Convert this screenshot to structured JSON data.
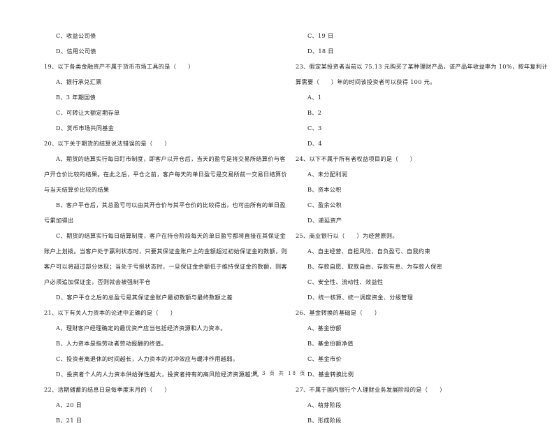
{
  "left_column": [
    {
      "type": "opt",
      "text": "C、收益公司债"
    },
    {
      "type": "opt",
      "text": "D、信用公司债"
    },
    {
      "type": "q",
      "text": "19、以下各类金融资产不属于货币市场工具的是（　　）"
    },
    {
      "type": "opt",
      "text": "A、银行承兑汇票"
    },
    {
      "type": "opt",
      "text": "B、3 年期国债"
    },
    {
      "type": "opt",
      "text": "C、可转让大额定期存单"
    },
    {
      "type": "opt",
      "text": "D、货币市场共同基金"
    },
    {
      "type": "q",
      "text": "20、以下关于期货的结算说法错误的是（　　）"
    },
    {
      "type": "opt",
      "text": "A、期货的结算实行每日盯市制度，即客户以开仓后，当天的盈亏是将交易所结算价与客"
    },
    {
      "type": "cont",
      "text": "户开仓价比较的结果。在此之后，平仓之前，客户每天的单日盈亏是交易所前一交易日结算价"
    },
    {
      "type": "cont",
      "text": "与当天结算价比较的结果"
    },
    {
      "type": "opt",
      "text": "B、客户平仓后，其总盈亏可以由其开仓价与其平仓价的比较得出，也可由所有的单日盈"
    },
    {
      "type": "cont",
      "text": "亏累加得出"
    },
    {
      "type": "opt",
      "text": "C、期货的结算实行每日结算制度，客户在持仓阶段每天的单日盈亏都将直接在其保证金"
    },
    {
      "type": "cont",
      "text": "账户上划拨。当客户处于赢利状态时，只要其保证金账户上的金额超过初始保证金的数额，则"
    },
    {
      "type": "cont",
      "text": "客户可以将超过部分体现；当处于亏损状态时，一旦保证金余额低于维持保证金的数额，则客"
    },
    {
      "type": "cont",
      "text": "户必须追加保证金，否则就会被强制平仓"
    },
    {
      "type": "opt",
      "text": "D、客户平仓之后的总盈亏是其保证金账户最初数额与最终数额之差"
    },
    {
      "type": "q",
      "text": "21、以下有关人力资本的论述中正确的是（　　）"
    },
    {
      "type": "opt",
      "text": "A、理财客户经理确定的最优资产应当包括经济资源和人力资本。"
    },
    {
      "type": "opt",
      "text": "B、人力资本是指劳动者劳动报酬的终值。"
    },
    {
      "type": "opt",
      "text": "C、投资者离退休的时间越长，人力资本的对冲效应与缓冲作用越弱。"
    },
    {
      "type": "opt",
      "text": "D、投资者个人的人力资本供给弹性越大，投资者持有的高风险经济资源越少。"
    },
    {
      "type": "q",
      "text": "22、活期储蓄的结息日是每季度末月的（　　）"
    },
    {
      "type": "opt",
      "text": "A、20 日"
    },
    {
      "type": "opt",
      "text": "B、21 日"
    }
  ],
  "right_column": [
    {
      "type": "opt",
      "text": "C、19 日"
    },
    {
      "type": "opt",
      "text": "D、18 日"
    },
    {
      "type": "q",
      "text": "23、假定某投资者当前以 75.13 元购买了某种理财产品，该产品年收益率为 10%，按年复利计"
    },
    {
      "type": "cont",
      "text": "算需要（　　）年的时间该投资者可以获得 100 元。"
    },
    {
      "type": "opt",
      "text": "A、1"
    },
    {
      "type": "opt",
      "text": "B、2"
    },
    {
      "type": "opt",
      "text": "C、3"
    },
    {
      "type": "opt",
      "text": "D、4"
    },
    {
      "type": "q",
      "text": "24、以下不属于所有者权益项目的是（　　）"
    },
    {
      "type": "opt",
      "text": "A、未分配利润"
    },
    {
      "type": "opt",
      "text": "B、资本公积"
    },
    {
      "type": "opt",
      "text": "C、盈余公积"
    },
    {
      "type": "opt",
      "text": "D、递延资产"
    },
    {
      "type": "q",
      "text": "25、商业银行以（　　）为经营原则。"
    },
    {
      "type": "opt",
      "text": "A、自主经营、自担风险、自负盈亏、自我约束"
    },
    {
      "type": "opt",
      "text": "B、存款自愿、取款自由、存款有息、为存款人保密"
    },
    {
      "type": "opt",
      "text": "C、安全性、流动性、效益性"
    },
    {
      "type": "opt",
      "text": "D、统一核算、统一调度资金、分级管理"
    },
    {
      "type": "q",
      "text": "26、基金转换的基础是（　　）"
    },
    {
      "type": "opt",
      "text": "A、基金份额"
    },
    {
      "type": "opt",
      "text": "B、基金份额净值"
    },
    {
      "type": "opt",
      "text": "C、基金市价"
    },
    {
      "type": "opt",
      "text": "D、基金转换比例"
    },
    {
      "type": "q",
      "text": "27、不属于国内银行个人理财业务发展阶段的是（　　）"
    },
    {
      "type": "opt",
      "text": "A、萌芽阶段"
    },
    {
      "type": "opt",
      "text": "B、形成阶段"
    }
  ],
  "footer": {
    "page_label": "第 3 页 共 18 页"
  }
}
